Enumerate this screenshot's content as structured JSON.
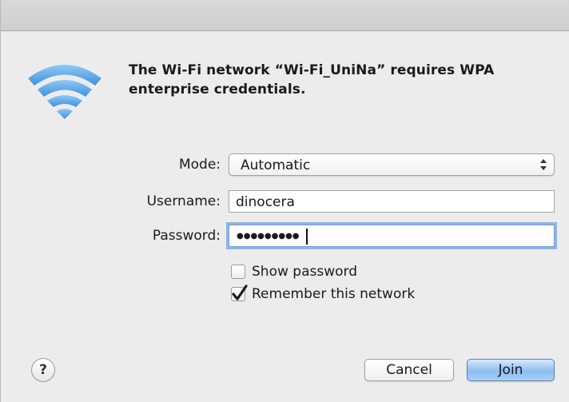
{
  "dialog": {
    "message": "The Wi-Fi network “Wi-Fi_UniNa” requires WPA enterprise credentials.",
    "icon": "wifi-icon"
  },
  "form": {
    "mode_label": "Mode:",
    "mode_value": "Automatic",
    "username_label": "Username:",
    "username_value": "dinocera",
    "password_label": "Password:",
    "password_value_masked": "●●●●●●●●●",
    "show_password_label": "Show password",
    "show_password_checked": false,
    "remember_label": "Remember this network",
    "remember_checked": true
  },
  "buttons": {
    "help_label": "?",
    "cancel_label": "Cancel",
    "join_label": "Join"
  },
  "colors": {
    "accent": "#8cbdf0",
    "wifi_icon": "#5aa6e8",
    "focus_ring": "#8cb6ea"
  }
}
